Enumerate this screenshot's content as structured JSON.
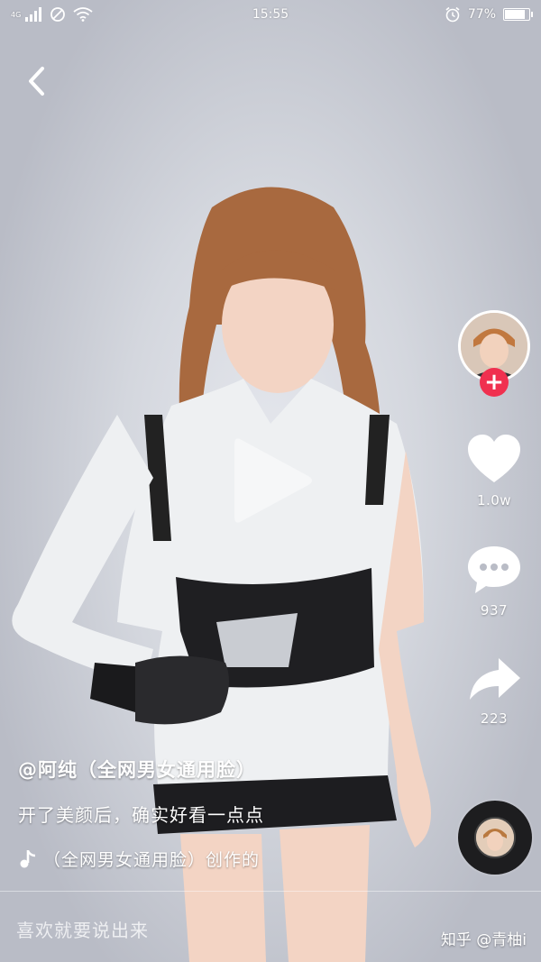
{
  "status_bar": {
    "network_type": "4G",
    "time": "15:55",
    "battery_percent": "77%",
    "battery_level": 0.77
  },
  "actions": {
    "like_count": "1.0w",
    "comment_count": "937",
    "share_count": "223"
  },
  "caption": {
    "author": "@阿纯（全网男女通用脸）",
    "description": "开了美颜后，确实好看一点点",
    "music": "（全网男女通用脸）创作的"
  },
  "comment_bar": {
    "placeholder": "喜欢就要说出来"
  },
  "watermark": "知乎 @青柚i",
  "colors": {
    "follow_accent": "#f0304f",
    "disc": "#1d1d1f"
  },
  "icons": {
    "back": "chevron-left-icon",
    "play": "play-icon",
    "like": "heart-icon",
    "comment": "comment-bubble-icon",
    "share": "share-arrow-icon",
    "follow": "plus-icon",
    "music": "music-note-icon"
  }
}
